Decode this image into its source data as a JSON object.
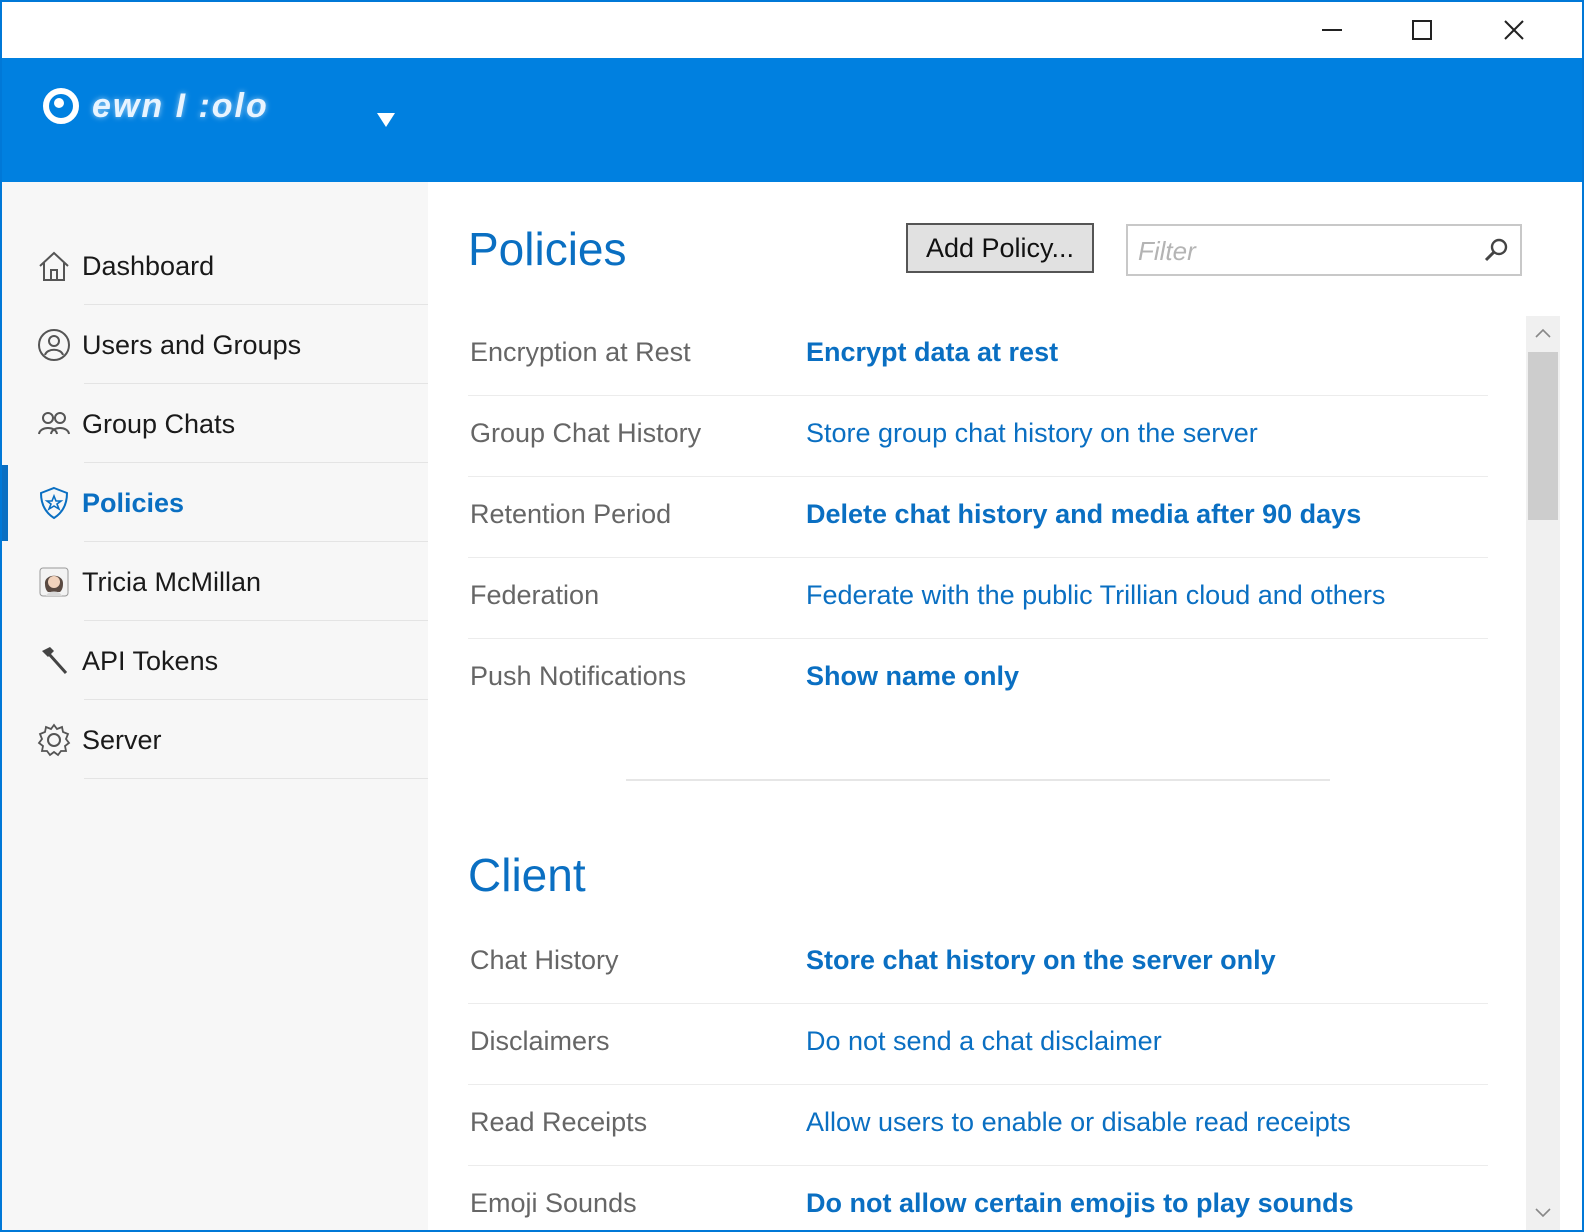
{
  "window": {
    "controls": [
      "minimize",
      "maximize",
      "close"
    ]
  },
  "header": {
    "logo_text": "ewn I :olo",
    "accent": "#0080e0"
  },
  "sidebar": {
    "items": [
      {
        "label": "Dashboard",
        "icon": "home-icon"
      },
      {
        "label": "Users and Groups",
        "icon": "user-icon"
      },
      {
        "label": "Group Chats",
        "icon": "group-icon"
      },
      {
        "label": "Policies",
        "icon": "shield-star-icon",
        "active": true
      },
      {
        "label": "Tricia McMillan",
        "icon": "person-avatar-icon"
      },
      {
        "label": "API Tokens",
        "icon": "hammer-icon"
      },
      {
        "label": "Server",
        "icon": "gear-icon"
      }
    ]
  },
  "main": {
    "title": "Policies",
    "add_button": "Add Policy...",
    "filter_placeholder": "Filter",
    "policies": [
      {
        "label": "Encryption at Rest",
        "value": "Encrypt data at rest",
        "bold": true
      },
      {
        "label": "Group Chat History",
        "value": "Store group chat history on the server",
        "bold": false
      },
      {
        "label": "Retention Period",
        "value": "Delete chat history and media after 90 days",
        "bold": true
      },
      {
        "label": "Federation",
        "value": "Federate with the public Trillian cloud and others",
        "bold": false
      },
      {
        "label": "Push Notifications",
        "value": "Show name only",
        "bold": true
      }
    ],
    "client_title": "Client",
    "client": [
      {
        "label": "Chat History",
        "value": "Store chat history on the server only",
        "bold": true
      },
      {
        "label": "Disclaimers",
        "value": "Do not send a chat disclaimer",
        "bold": false
      },
      {
        "label": "Read Receipts",
        "value": "Allow users to enable or disable read receipts",
        "bold": false
      },
      {
        "label": "Emoji Sounds",
        "value": "Do not allow certain emojis to play sounds",
        "bold": true
      }
    ]
  },
  "colors": {
    "link": "#0a6fc2",
    "label": "#666666"
  }
}
